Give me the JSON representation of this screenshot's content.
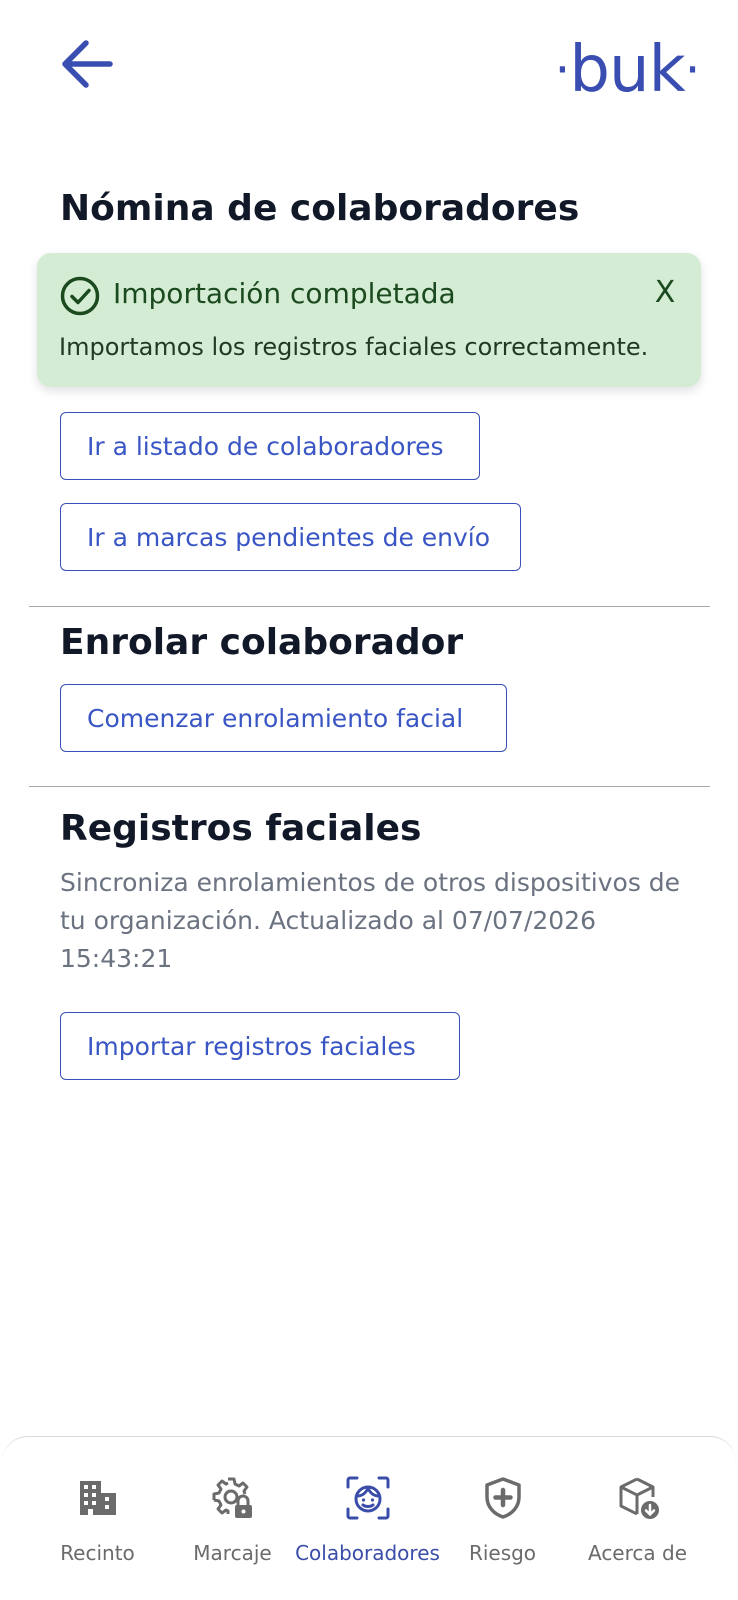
{
  "header": {
    "back_icon": "arrow-left-icon",
    "logo_text": "buk"
  },
  "colors": {
    "brand": "#3a4db1",
    "button_text": "#3a56c4",
    "toast_bg": "#d4ecd4",
    "toast_text": "#1b4a1f",
    "title_text": "#111827",
    "muted_text": "#6b7280",
    "nav_active": "#3a4da8",
    "nav_inactive": "#6b6b6b"
  },
  "nomina": {
    "title": "Nómina de colaboradores",
    "buttons": {
      "list": "Ir a listado de colaboradores",
      "pending": "Ir a marcas pendientes de envío"
    }
  },
  "enrolar": {
    "title": "Enrolar colaborador",
    "button": "Comenzar enrolamiento facial"
  },
  "registros": {
    "title": "Registros faciales",
    "description": "Sincroniza enrolamientos de otros dispositivos de tu organización. Actualizado al 07/07/2026 15:43:21",
    "button": "Importar registros faciales"
  },
  "toast": {
    "icon": "check-circle-icon",
    "title": "Importación completada",
    "message": "Importamos los registros faciales correctamente.",
    "close_label": "X"
  },
  "bottom_nav": {
    "active_index": 2,
    "items": [
      {
        "label": "Recinto",
        "icon": "building-icon"
      },
      {
        "label": "Marcaje",
        "icon": "gear-lock-icon"
      },
      {
        "label": "Colaboradores",
        "icon": "face-scan-icon"
      },
      {
        "label": "Riesgo",
        "icon": "shield-plus-icon"
      },
      {
        "label": "Acerca de",
        "icon": "box-download-icon"
      }
    ]
  }
}
